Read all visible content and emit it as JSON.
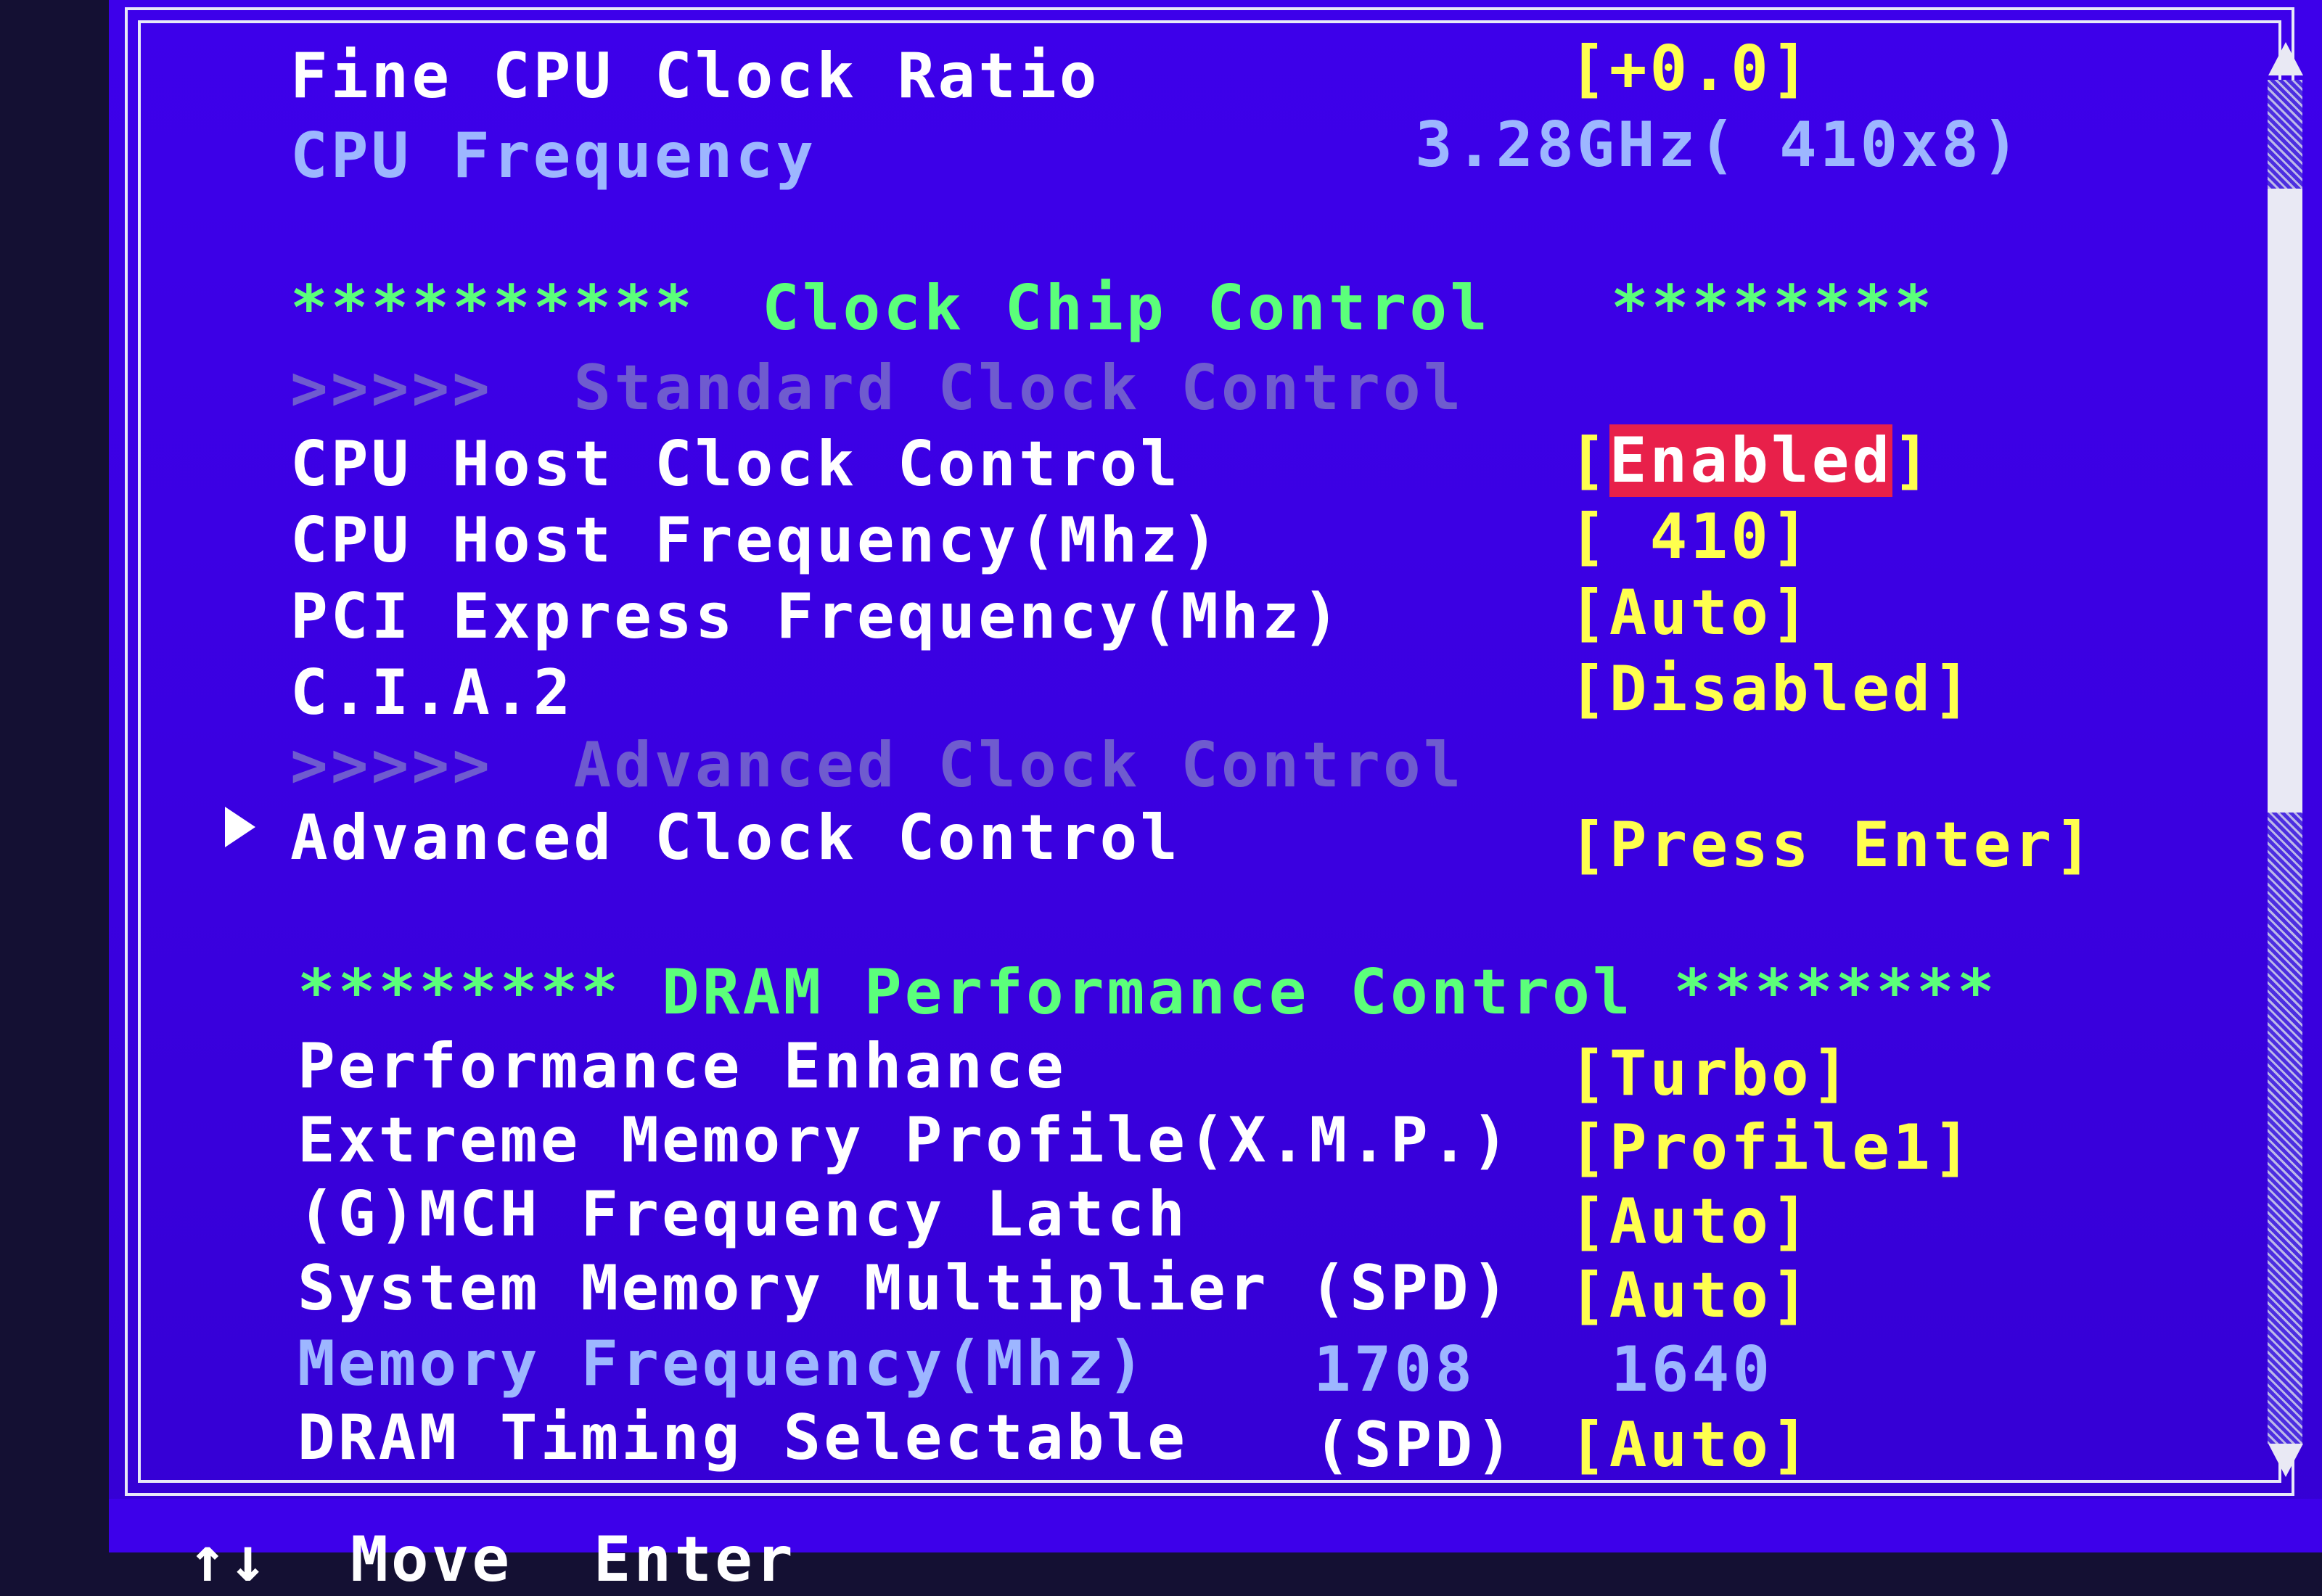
{
  "header": {
    "fine_ratio_label": "Fine CPU Clock Ratio",
    "fine_ratio_value": "[+0.0]",
    "cpu_freq_label": "CPU Frequency",
    "cpu_freq_value": "3.28GHz( 410x8)"
  },
  "clock_chip": {
    "title_left_stars": "**********",
    "title": "Clock Chip Control",
    "title_right_stars": "********",
    "standard_sub": ">>>>>  Standard Clock Control",
    "items": [
      {
        "label": "CPU Host Clock Control",
        "value_open": "[",
        "value": "Enabled",
        "value_close": "]"
      },
      {
        "label": "CPU Host Frequency(Mhz)",
        "value": "[ 410]"
      },
      {
        "label": "PCI Express Frequency(Mhz)",
        "value": "[Auto]"
      },
      {
        "label": "C.I.A.2",
        "value": "[Disabled]"
      }
    ],
    "advanced_sub": ">>>>>  Advanced Clock Control",
    "advanced_item": {
      "label": "Advanced Clock Control",
      "value": "[Press Enter]"
    }
  },
  "dram": {
    "title": "******** DRAM Performance Control ********",
    "items": [
      {
        "label": "Performance Enhance",
        "value": "[Turbo]"
      },
      {
        "label": "Extreme Memory Profile(X.M.P.)",
        "value": "[Profile1]"
      },
      {
        "label": "(G)MCH Frequency Latch",
        "value": "[Auto]"
      },
      {
        "label": "System Memory Multiplier (SPD)",
        "value": "[Auto]"
      }
    ],
    "mem_freq_label": "Memory Frequency(Mhz)",
    "mem_freq_spd": "1708",
    "mem_freq_current": "1640",
    "timing_label": "DRAM Timing Selectable",
    "timing_spd": "(SPD)",
    "timing_value": "[Auto]"
  },
  "bottom_hint": "↑↓  Move  Enter"
}
